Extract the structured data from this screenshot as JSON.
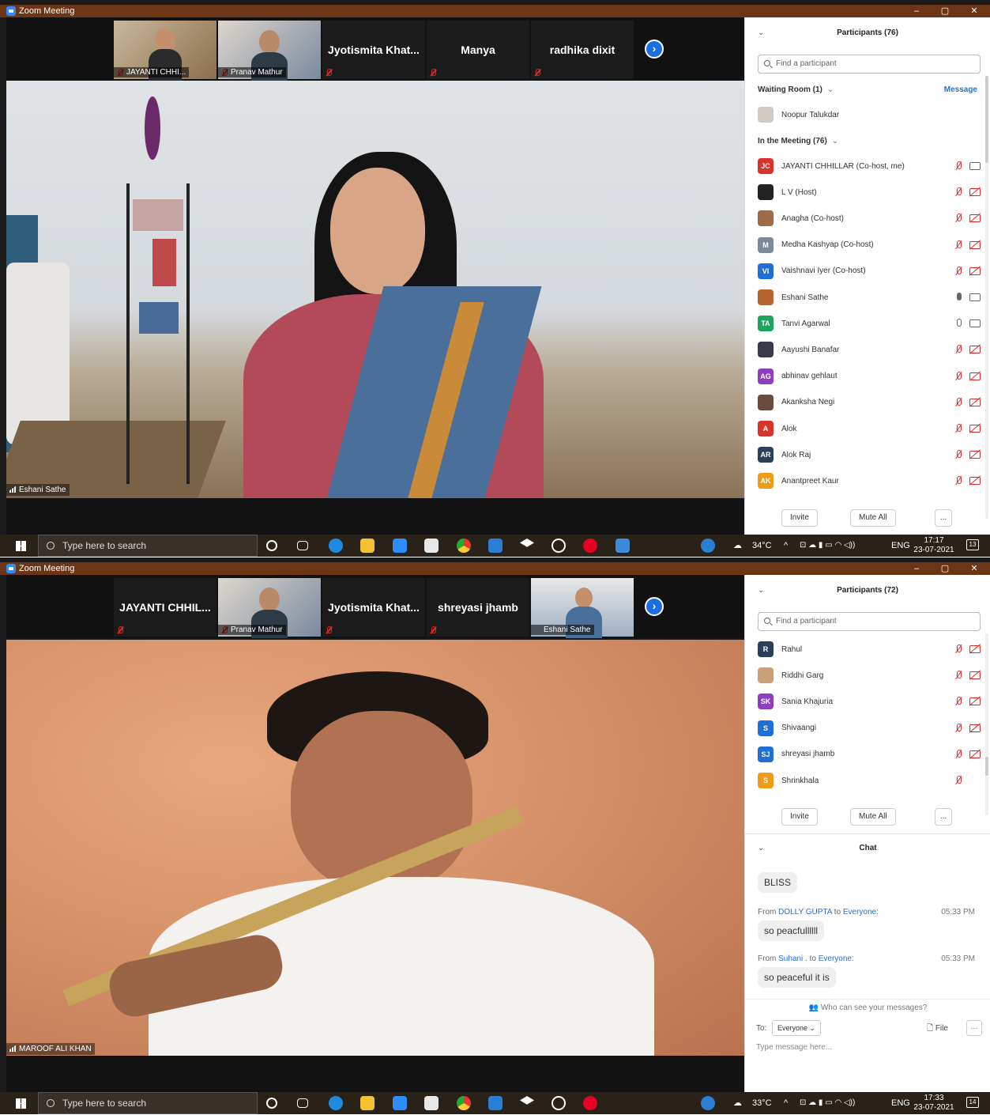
{
  "panel1": {
    "window_title": "Zoom Meeting",
    "thumbnails": [
      {
        "name": "JAYANTI CHHI...",
        "type": "video"
      },
      {
        "name": "Pranav Mathur",
        "type": "video"
      },
      {
        "name": "Jyotismita  Khat...",
        "type": "name"
      },
      {
        "name": "Manya",
        "type": "name"
      },
      {
        "name": "radhika dixit",
        "type": "name"
      }
    ],
    "speaker_label": "Eshani Sathe",
    "participants": {
      "title": "Participants (76)",
      "search_placeholder": "Find a participant",
      "waiting_room": "Waiting Room (1)",
      "message_label": "Message",
      "waiting": [
        {
          "name": "Noopur Talukdar"
        }
      ],
      "in_meeting": "In the Meeting (76)",
      "list": [
        {
          "initials": "JC",
          "name": "JAYANTI CHHILLAR (Co-host, me)",
          "color": "#d9342b",
          "mic": "off",
          "cam": "on"
        },
        {
          "initials": "",
          "name": "L V (Host)",
          "color": "#222222",
          "mic": "off",
          "cam": "off"
        },
        {
          "initials": "",
          "name": "Anagha (Co-host)",
          "color": "#9b6b4a",
          "mic": "off",
          "cam": "off"
        },
        {
          "initials": "M",
          "name": "Medha Kashyap (Co-host)",
          "color": "#7b8a9a",
          "mic": "off",
          "cam": "off"
        },
        {
          "initials": "VI",
          "name": "Vaishnavi Iyer (Co-host)",
          "color": "#1f6fd6",
          "mic": "off",
          "cam": "off"
        },
        {
          "initials": "",
          "name": "Eshani Sathe",
          "color": "#b5652d",
          "mic": "live",
          "cam": "on"
        },
        {
          "initials": "TA",
          "name": "Tanvi Agarwal",
          "color": "#1ea362",
          "mic": "on",
          "cam": "on"
        },
        {
          "initials": "",
          "name": "Aayushi Banafar",
          "color": "#3a3a4a",
          "mic": "off",
          "cam": "off"
        },
        {
          "initials": "AG",
          "name": "abhinav gehlaut",
          "color": "#8e3fc0",
          "mic": "off",
          "cam": "off"
        },
        {
          "initials": "",
          "name": "Akanksha Negi",
          "color": "#6a4a3a",
          "mic": "off",
          "cam": "off"
        },
        {
          "initials": "A",
          "name": "Alok",
          "color": "#d9342b",
          "mic": "off",
          "cam": "off"
        },
        {
          "initials": "AR",
          "name": "Alok Raj",
          "color": "#2b3e5a",
          "mic": "off",
          "cam": "off"
        },
        {
          "initials": "AK",
          "name": "Anantpreet Kaur",
          "color": "#f09a1a",
          "mic": "off",
          "cam": "off"
        }
      ],
      "invite": "Invite",
      "mute_all": "Mute All",
      "more": "..."
    },
    "taskbar": {
      "search": "Type here to search",
      "temp": "34°C",
      "lang": "ENG",
      "time": "17:17",
      "date": "23-07-2021",
      "notif": "13"
    }
  },
  "panel2": {
    "window_title": "Zoom Meeting",
    "thumbnails": [
      {
        "name": "JAYANTI CHHIL...",
        "type": "name"
      },
      {
        "name": "Pranav Mathur",
        "type": "video"
      },
      {
        "name": "Jyotismita  Khat...",
        "type": "name"
      },
      {
        "name": "shreyasi jhamb",
        "type": "name"
      },
      {
        "name": "Eshani Sathe",
        "type": "video"
      }
    ],
    "speaker_label": "MAROOF ALI KHAN",
    "participants": {
      "title": "Participants (72)",
      "search_placeholder": "Find a participant",
      "list": [
        {
          "initials": "R",
          "name": "Rahul",
          "color": "#2b3e5a",
          "mic": "off",
          "cam": "off"
        },
        {
          "initials": "",
          "name": "Riddhi Garg",
          "color": "#c9a07a",
          "mic": "off",
          "cam": "off"
        },
        {
          "initials": "SK",
          "name": "Sania Khajuria",
          "color": "#8e3fc0",
          "mic": "off",
          "cam": "off"
        },
        {
          "initials": "S",
          "name": "Shivaangi",
          "color": "#1f6fd6",
          "mic": "off",
          "cam": "off"
        },
        {
          "initials": "SJ",
          "name": "shreyasi jhamb",
          "color": "#1f6fd6",
          "mic": "off",
          "cam": "off"
        },
        {
          "initials": "S",
          "name": "Shrinkhala",
          "color": "#f09a1a",
          "mic": "off",
          "cam": "none"
        }
      ],
      "invite": "Invite",
      "mute_all": "Mute All",
      "more": "..."
    },
    "chat": {
      "title": "Chat",
      "messages": [
        {
          "text": "BLISS"
        },
        {
          "from": "DOLLY GUPTA",
          "to": "Everyone",
          "time": "05:33 PM",
          "text": "so peacfullllll"
        },
        {
          "from": "Suhani .",
          "to": "Everyone",
          "time": "05:33 PM",
          "text": "so peaceful it is"
        }
      ],
      "who_can_see": "Who can see your messages?",
      "to_label": "To:",
      "to_value": "Everyone",
      "file_label": "File",
      "more": "···",
      "placeholder": "Type message here..."
    },
    "taskbar": {
      "search": "Type here to search",
      "temp": "33°C",
      "lang": "ENG",
      "time": "17:33",
      "date": "23-07-2021",
      "notif": "14"
    }
  },
  "shared": {
    "from_word": "From",
    "to_word": "to"
  }
}
